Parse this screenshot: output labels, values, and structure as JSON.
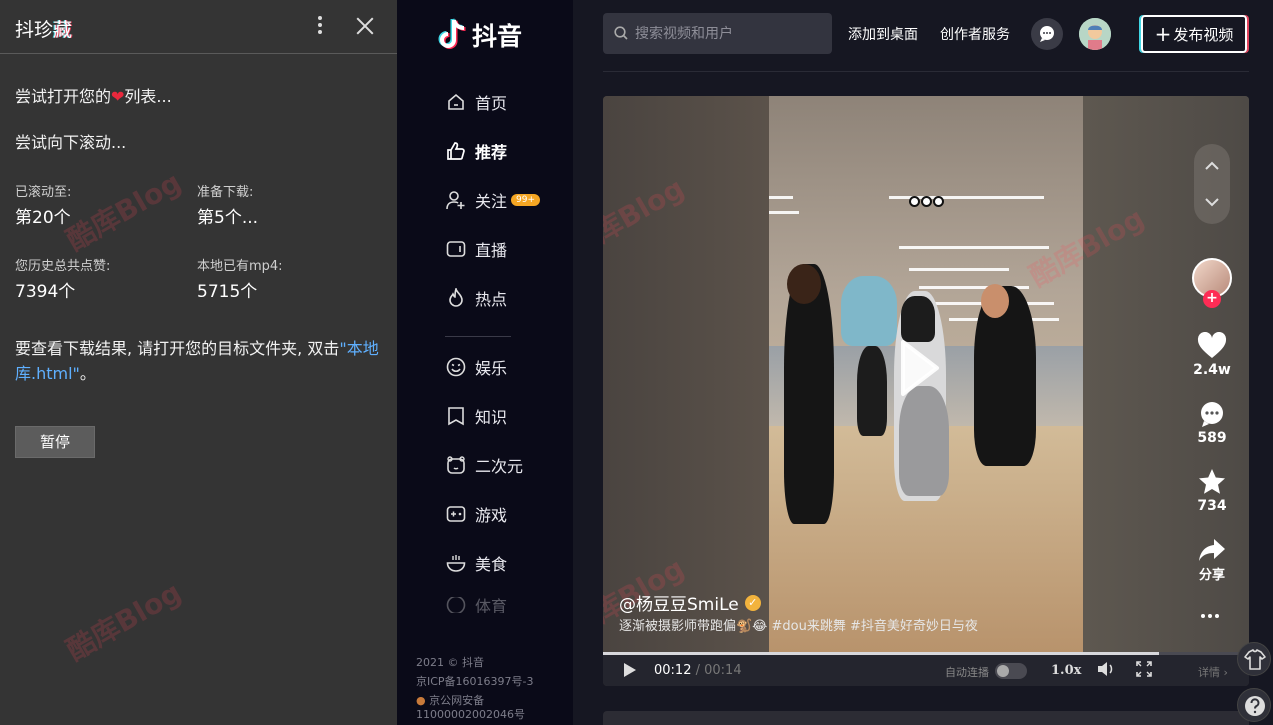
{
  "extension": {
    "title_a": "抖珍",
    "title_b": "藏",
    "line1_pre": "尝试打开您的",
    "line1_post": "列表...",
    "line2": "尝试向下滚动...",
    "scrolled_label": "已滚动至:",
    "scrolled_value": "第20个",
    "prep_label": "准备下载:",
    "prep_value": "第5个...",
    "likes_label": "您历史总共点赞:",
    "likes_value": "7394个",
    "mp4_label": "本地已有mp4:",
    "mp4_value": "5715个",
    "note_pre": "要查看下载结果, 请打开您的目标文件夹, 双击",
    "note_link": "\"本地库.html\"",
    "note_post": "。",
    "pause_label": "暂停"
  },
  "sidebar": {
    "logo_text": "抖音",
    "items": [
      {
        "label": "首页",
        "icon": "home-icon"
      },
      {
        "label": "推荐",
        "icon": "thumbs-up-icon"
      },
      {
        "label": "关注",
        "icon": "user-add-icon",
        "badge": "99+"
      },
      {
        "label": "直播",
        "icon": "tv-icon"
      },
      {
        "label": "热点",
        "icon": "flame-icon"
      },
      {
        "label": "娱乐",
        "icon": "smile-icon"
      },
      {
        "label": "知识",
        "icon": "book-icon"
      },
      {
        "label": "二次元",
        "icon": "bear-icon"
      },
      {
        "label": "游戏",
        "icon": "gamepad-icon"
      },
      {
        "label": "美食",
        "icon": "bowl-icon"
      },
      {
        "label": "体育",
        "icon": "ball-icon"
      }
    ],
    "footer": [
      "2021 © 抖音",
      "京ICP备16016397号-3",
      "京公网安备",
      "11000002002046号"
    ]
  },
  "topbar": {
    "search_placeholder": "搜索视频和用户",
    "add_to_desktop": "添加到桌面",
    "creator_service": "创作者服务",
    "publish_label": "发布视频"
  },
  "video": {
    "author": "@杨豆豆SmiLe",
    "description": "逐渐被摄影师带跑偏🐒😂 #dou来跳舞 #抖音美好奇妙日与夜",
    "likes": "2.4w",
    "comments": "589",
    "favorites": "734",
    "share": "分享",
    "time_current": "00:12",
    "time_total": "00:14",
    "progress": 0.86,
    "autoplay_label": "自动连播",
    "speed": "1.0x",
    "detail": "详情"
  },
  "colors": {
    "panel_bg": "#343434",
    "sidebar_bg": "#0a0a18",
    "page_bg": "#161722",
    "accent_red": "#fe2c55",
    "accent_cyan": "#3fd6e4",
    "badge_orange": "#f5a623",
    "link_blue": "#5fb0ff"
  }
}
